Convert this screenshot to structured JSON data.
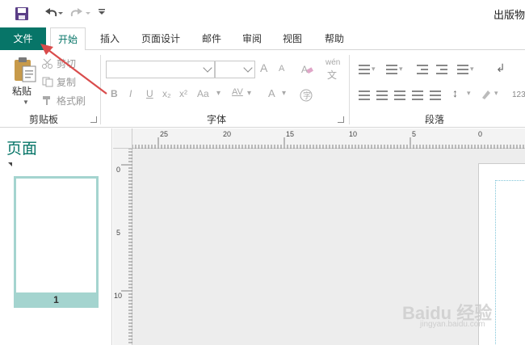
{
  "window": {
    "title": "出版物"
  },
  "quick_access": {
    "save_icon": "save-icon",
    "undo_icon": "undo-icon",
    "redo_icon": "redo-icon",
    "customize_icon": "chevron-down-icon"
  },
  "tabs": [
    {
      "label": "文件",
      "active": false
    },
    {
      "label": "开始",
      "active": true
    },
    {
      "label": "插入"
    },
    {
      "label": "页面设计"
    },
    {
      "label": "邮件"
    },
    {
      "label": "审阅"
    },
    {
      "label": "视图"
    },
    {
      "label": "帮助"
    }
  ],
  "ribbon": {
    "clipboard": {
      "label": "剪贴板",
      "paste": "粘贴",
      "cut": "剪切",
      "copy": "复制",
      "format_painter": "格式刷"
    },
    "font": {
      "label": "字体",
      "bold": "B",
      "italic": "I",
      "underline": "U",
      "subscript": "x₂",
      "superscript": "x²",
      "change_case": "Aa",
      "char_spacing": "AV",
      "font_color": "A",
      "grow": "A",
      "shrink": "A",
      "phonetic": "wén"
    },
    "paragraph": {
      "label": "段落",
      "numbering_value": "123"
    }
  },
  "pages_panel": {
    "title": "页面",
    "pages": [
      {
        "number": "1"
      }
    ]
  },
  "rulers": {
    "horizontal": [
      "25",
      "20",
      "15",
      "10",
      "5",
      "0"
    ],
    "vertical": [
      "0",
      "5",
      "10"
    ]
  },
  "watermark": {
    "brand": "Baidu 经验",
    "url": "jingyan.baidu.com"
  },
  "colors": {
    "accent": "#077568",
    "thumb_border": "#a4d4cf",
    "annotation_arrow": "#d94c4c"
  }
}
